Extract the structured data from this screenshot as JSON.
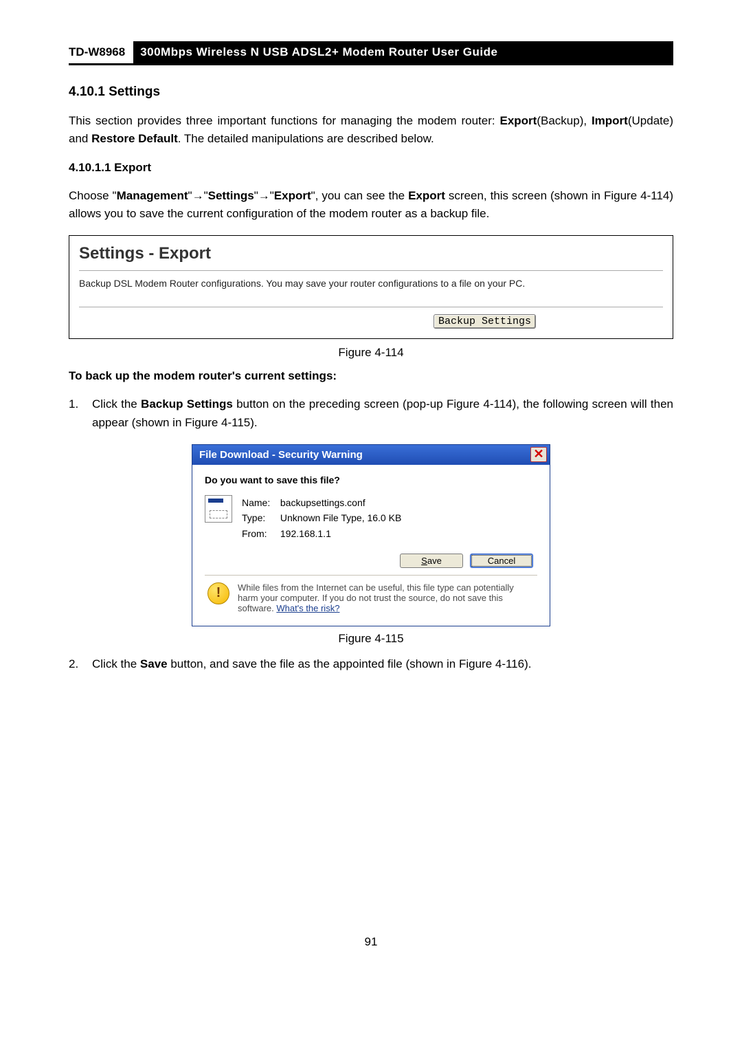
{
  "header": {
    "model": "TD-W8968",
    "title": "300Mbps Wireless N USB ADSL2+ Modem Router User Guide"
  },
  "section": {
    "num_title": "4.10.1 Settings",
    "intro_pre": "This section provides three important functions for managing the modem router: ",
    "b1": "Export",
    "intro_mid1": "(Backup), ",
    "b2": "Import",
    "intro_mid2": "(Update) and ",
    "b3": "Restore Default",
    "intro_post": ". The detailed manipulations are described below."
  },
  "export": {
    "heading": "4.10.1.1 Export",
    "p_pre": "Choose \"",
    "mgmt": "Management",
    "arrow": "→",
    "settings": "Settings",
    "exp": "Export",
    "p_mid1": "\", you can see the ",
    "exp2": "Export",
    "p_post": " screen, this screen (shown in Figure 4-114) allows you to save the current configuration of the modem router as a backup file."
  },
  "panel": {
    "title": "Settings - Export",
    "body": "Backup DSL Modem Router configurations. You may save your router configurations to a file on your PC.",
    "button": "Backup Settings"
  },
  "fig1": "Figure 4-114",
  "steps_heading": "To back up the modem router's current settings:",
  "step1": {
    "num": "1.",
    "pre": "Click the ",
    "btn": "Backup Settings",
    "post": " button on the preceding screen (pop-up Figure 4-114), the following screen will then appear (shown in Figure 4-115)."
  },
  "dialog": {
    "title": "File Download - Security Warning",
    "question": "Do you want to save this file?",
    "name_lbl": "Name:",
    "name_val": "backupsettings.conf",
    "type_lbl": "Type:",
    "type_val": "Unknown File Type, 16.0 KB",
    "from_lbl": "From:",
    "from_val": "192.168.1.1",
    "save": "Save",
    "cancel": "Cancel",
    "warn": "While files from the Internet can be useful, this file type can potentially harm your computer. If you do not trust the source, do not save this software. ",
    "risk": "What's the risk?"
  },
  "fig2": "Figure 4-115",
  "step2": {
    "num": "2.",
    "pre": "Click the ",
    "btn": "Save",
    "post": " button, and save the file as the appointed file (shown in Figure 4-116)."
  },
  "page_number": "91"
}
